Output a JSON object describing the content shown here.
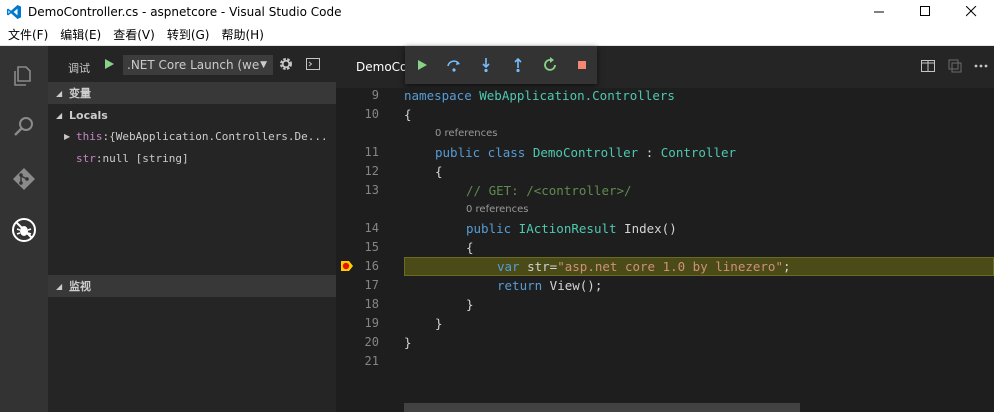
{
  "window": {
    "title": "DemoController.cs - aspnetcore - Visual Studio Code",
    "logo_color": "#007acc"
  },
  "menu": {
    "items": [
      "文件(F)",
      "编辑(E)",
      "查看(V)",
      "转到(G)",
      "帮助(H)"
    ]
  },
  "activity": {
    "icons": [
      "explorer-icon",
      "search-icon",
      "git-icon",
      "debug-icon"
    ]
  },
  "debug_panel": {
    "title": "调试",
    "configuration": ".NET Core Launch (we",
    "sections": {
      "variables": "变量",
      "locals": "Locals",
      "watch": "监视"
    },
    "locals": [
      {
        "name": "this",
        "value": " {WebApplication.Controllers.De..."
      },
      {
        "name": "str",
        "value": " null [string]"
      }
    ]
  },
  "editor": {
    "tab": "DemoCo",
    "line_numbers": [
      "9",
      "10",
      "11",
      "12",
      "13",
      "14",
      "15",
      "16",
      "17",
      "18",
      "19",
      "20",
      "21"
    ],
    "codelens": [
      "0 references",
      "0 references"
    ],
    "code": {
      "l9_kw": "namespace",
      "l9_name": " WebApplication.Controllers",
      "l10": "{",
      "l11_kw": "public class",
      "l11_name": " DemoController",
      "l11_colon": " : ",
      "l11_base": "Controller",
      "l12": "{",
      "l13": "// GET: /<controller>/",
      "l14_kw": "public",
      "l14_type": " IActionResult",
      "l14_rest": " Index()",
      "l15": "{",
      "l16_kw": "var",
      "l16_mid": " str=",
      "l16_str": "\"asp.net core 1.0 by linezero\"",
      "l16_end": ";",
      "l17_kw": "return",
      "l17_rest": " View();",
      "l18": "}",
      "l19": "}",
      "l20": "}"
    }
  },
  "colors": {
    "accent": "#007acc",
    "continue": "#89d185",
    "stop": "#f48771",
    "step": "#75beff",
    "highlight": "#4b4b18"
  }
}
